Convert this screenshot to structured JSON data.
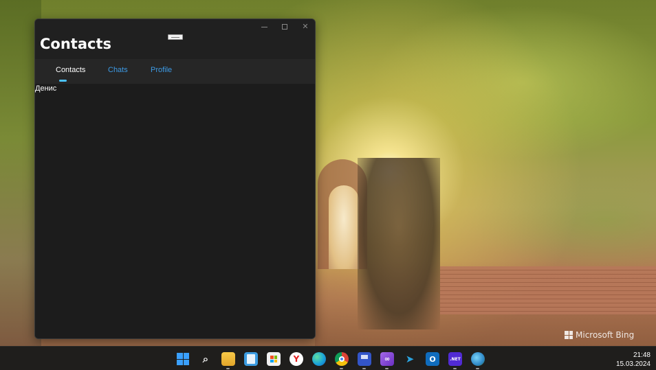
{
  "window": {
    "title": "Contacts",
    "tabs": [
      {
        "label": "Contacts",
        "active": true
      },
      {
        "label": "Chats",
        "active": false
      },
      {
        "label": "Profile",
        "active": false
      }
    ],
    "contacts": [
      "Денис"
    ],
    "accent_color": "#4cc2ff",
    "link_color": "#3d9be6"
  },
  "wallpaper": {
    "watermark": "Microsoft Bing"
  },
  "taskbar": {
    "icons": [
      {
        "name": "start-icon",
        "glyph": ""
      },
      {
        "name": "search-icon",
        "glyph": "🔍"
      },
      {
        "name": "file-explorer-icon",
        "glyph": ""
      },
      {
        "name": "notepad-icon",
        "glyph": ""
      },
      {
        "name": "microsoft-store-icon",
        "glyph": ""
      },
      {
        "name": "yandex-browser-icon",
        "glyph": "Y"
      },
      {
        "name": "edge-icon",
        "glyph": ""
      },
      {
        "name": "chrome-icon",
        "glyph": ""
      },
      {
        "name": "save-disk-icon",
        "glyph": ""
      },
      {
        "name": "visual-studio-icon",
        "glyph": ""
      },
      {
        "name": "telegram-icon",
        "glyph": ""
      },
      {
        "name": "outlook-icon",
        "glyph": "O"
      },
      {
        "name": "dotnet-icon",
        "glyph": ".NET"
      },
      {
        "name": "globe-app-icon",
        "glyph": ""
      }
    ],
    "time": "21:48",
    "date": "15.03.2024"
  }
}
